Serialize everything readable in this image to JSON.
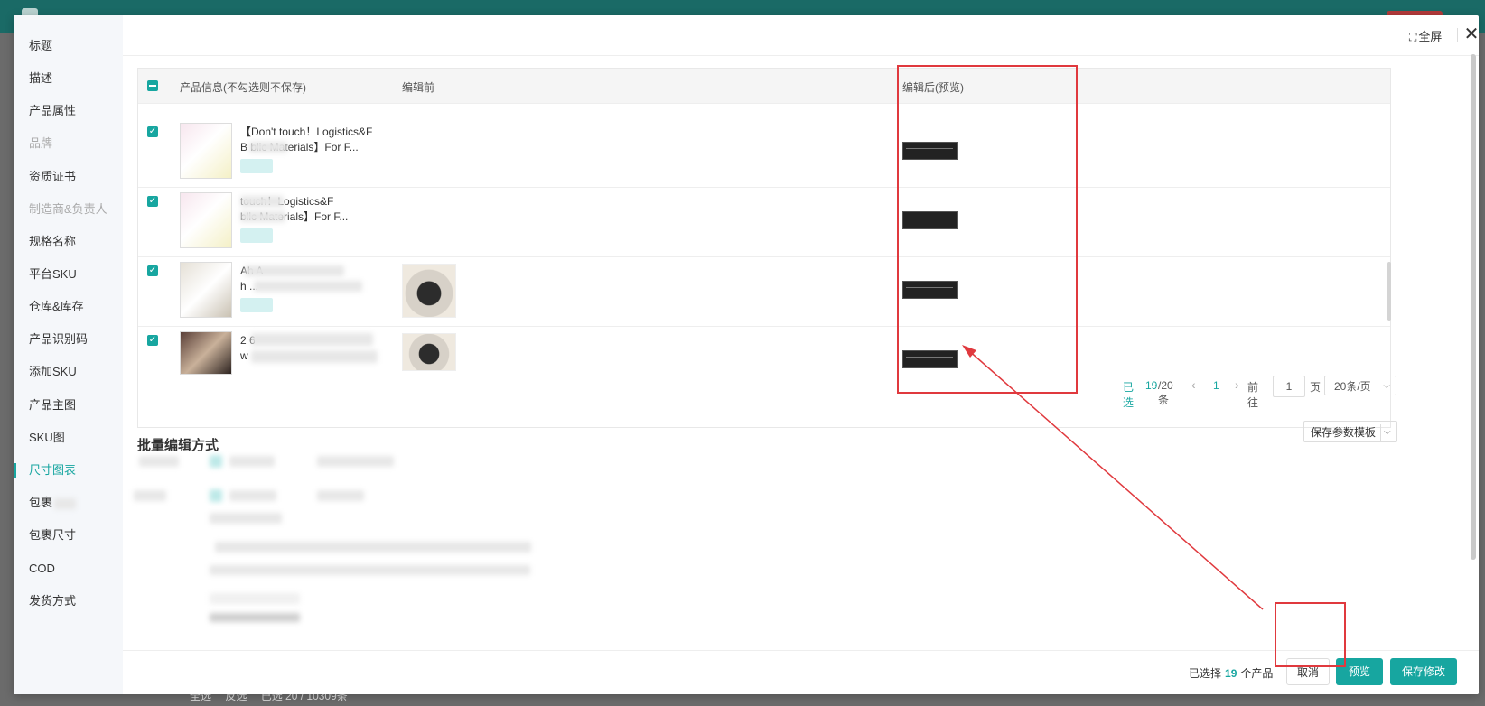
{
  "nav": {
    "items": [
      {
        "label": "标题",
        "state": "normal"
      },
      {
        "label": "描述",
        "state": "normal"
      },
      {
        "label": "产品属性",
        "state": "normal"
      },
      {
        "label": "品牌",
        "state": "disabled"
      },
      {
        "label": "资质证书",
        "state": "normal"
      },
      {
        "label": "制造商&负责人",
        "state": "disabled"
      },
      {
        "label": "规格名称",
        "state": "normal"
      },
      {
        "label": "平台SKU",
        "state": "normal"
      },
      {
        "label": "仓库&库存",
        "state": "normal"
      },
      {
        "label": "产品识别码",
        "state": "normal"
      },
      {
        "label": "添加SKU",
        "state": "normal"
      },
      {
        "label": "产品主图",
        "state": "normal"
      },
      {
        "label": "SKU图",
        "state": "normal"
      },
      {
        "label": "尺寸图表",
        "state": "active"
      },
      {
        "label": "包裹",
        "state": "normal"
      },
      {
        "label": "包裹尺寸",
        "state": "normal"
      },
      {
        "label": "COD",
        "state": "normal"
      },
      {
        "label": "发货方式",
        "state": "normal"
      }
    ]
  },
  "header": {
    "fullscreen_label": "全屏",
    "close_label": "✕"
  },
  "table": {
    "columns": {
      "product_info": "产品信息(不勾选则不保存)",
      "before": "编辑前",
      "after": "编辑后(预览)"
    },
    "rows": [
      {
        "title_lines": [
          "【Don't touch！Logistics&F",
          "B        blic Materials】For F..."
        ],
        "checked": true,
        "has_before_image": false
      },
      {
        "title_lines": [
          "         touch！Logistics&F",
          "         blic Materials】For F..."
        ],
        "checked": true,
        "has_before_image": false
      },
      {
        "title_lines": [
          "                        Ah A",
          "h                              ..."
        ],
        "checked": true,
        "has_before_image": true
      },
      {
        "title_lines": [
          "2         6",
          "            w"
        ],
        "checked": true,
        "has_before_image": true
      }
    ]
  },
  "pagination": {
    "selected_label": "已选",
    "selected_count": "19",
    "total": "/20条",
    "prev": "‹",
    "current_page": "1",
    "next": "›",
    "goto_label": "前往",
    "page_input": "1",
    "page_unit": "页",
    "page_size": "20条/页"
  },
  "batch": {
    "title": "批量编辑方式",
    "template_button": "保存参数模板"
  },
  "footer": {
    "selected_prefix": "已选择",
    "selected_count": "19",
    "selected_suffix": "个产品",
    "cancel": "取消",
    "preview": "预览",
    "save": "保存修改"
  },
  "background": {
    "bottom_items": [
      "全选",
      "反选",
      "已选 20 / 10309条"
    ]
  },
  "colors": {
    "accent": "#17a6a0",
    "annotation": "#e0393e"
  }
}
